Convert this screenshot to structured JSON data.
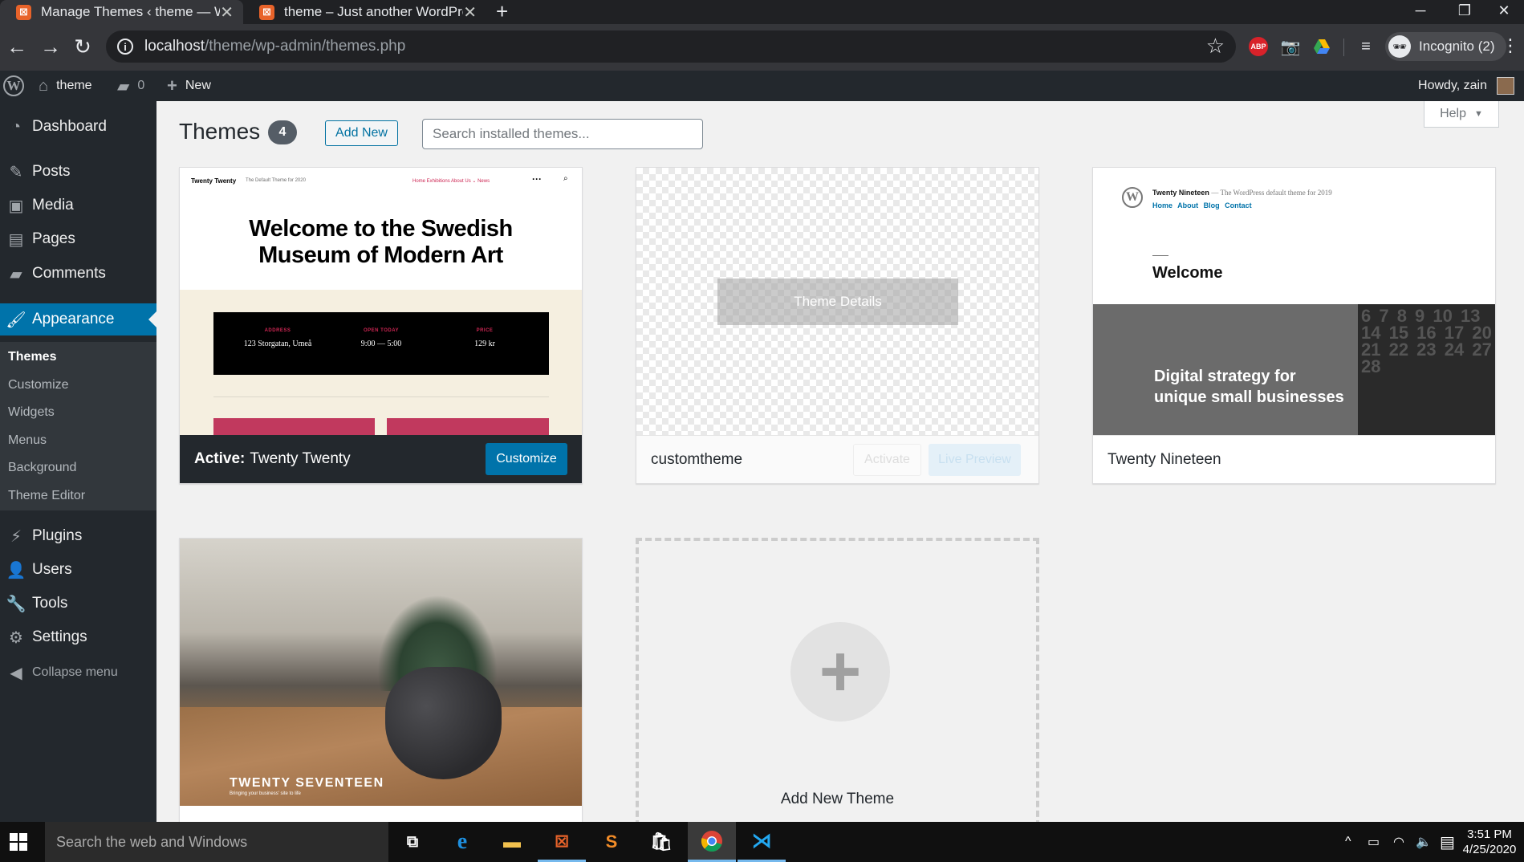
{
  "browser": {
    "tabs": [
      {
        "title": "Manage Themes ‹ theme — WordPress",
        "active": true
      },
      {
        "title": "theme – Just another WordPress site",
        "active": false
      }
    ],
    "url_host": "localhost",
    "url_path": "/theme/wp-admin/themes.php",
    "incognito_label": "Incognito (2)",
    "abp_label": "ABP"
  },
  "adminbar": {
    "site_name": "theme",
    "comment_count": "0",
    "new_label": "New",
    "greeting": "Howdy, zain"
  },
  "sidebar": {
    "items": [
      {
        "label": "Dashboard",
        "icon": "dashboard-icon"
      },
      {
        "label": "Posts",
        "icon": "pin-icon"
      },
      {
        "label": "Media",
        "icon": "media-icon"
      },
      {
        "label": "Pages",
        "icon": "pages-icon"
      },
      {
        "label": "Comments",
        "icon": "comment-icon"
      },
      {
        "label": "Appearance",
        "icon": "brush-icon",
        "current": true
      },
      {
        "label": "Plugins",
        "icon": "plug-icon"
      },
      {
        "label": "Users",
        "icon": "user-icon"
      },
      {
        "label": "Tools",
        "icon": "wrench-icon"
      },
      {
        "label": "Settings",
        "icon": "settings-icon"
      }
    ],
    "submenu": [
      "Themes",
      "Customize",
      "Widgets",
      "Menus",
      "Background",
      "Theme Editor"
    ],
    "collapse_label": "Collapse menu"
  },
  "page": {
    "title": "Themes",
    "count": "4",
    "add_new_label": "Add New",
    "search_placeholder": "Search installed themes...",
    "help_label": "Help"
  },
  "themes": {
    "twentytwenty": {
      "active_prefix": "Active:",
      "name": "Twenty Twenty",
      "customize_label": "Customize",
      "preview": {
        "brand": "Twenty Twenty",
        "tagline": "The Default Theme for 2020",
        "nav": "Home    Exhibitions    About Us ⌄    News",
        "headline": "Welcome to the Swedish Museum of Modern Art",
        "info": [
          {
            "label": "ADDRESS",
            "value": "123 Storgatan, Umeå"
          },
          {
            "label": "OPEN TODAY",
            "value": "9:00 — 5:00"
          },
          {
            "label": "PRICE",
            "value": "129 kr"
          }
        ]
      }
    },
    "customtheme": {
      "name": "customtheme",
      "details_label": "Theme Details",
      "activate_label": "Activate",
      "live_preview_label": "Live Preview"
    },
    "twentynineteen": {
      "name": "Twenty Nineteen",
      "preview": {
        "site_title": "Twenty Nineteen",
        "tagline": "— The WordPress default theme for 2019",
        "nav": "Home About Blog Contact",
        "welcome": "Welcome",
        "hero_line1": "Digital strategy for",
        "hero_line2": "unique small businesses",
        "calendar": "6 7 8 9 10 13 14 15 16 17 20 21 22 23 24 27 28"
      }
    },
    "twentyseventeen": {
      "title": "TWENTY SEVENTEEN",
      "subtitle": "Bringing your business' site to life"
    },
    "add_new_theme_label": "Add New Theme"
  },
  "taskbar": {
    "search_placeholder": "Search the web and Windows",
    "time": "3:51 PM",
    "date": "4/25/2020"
  }
}
